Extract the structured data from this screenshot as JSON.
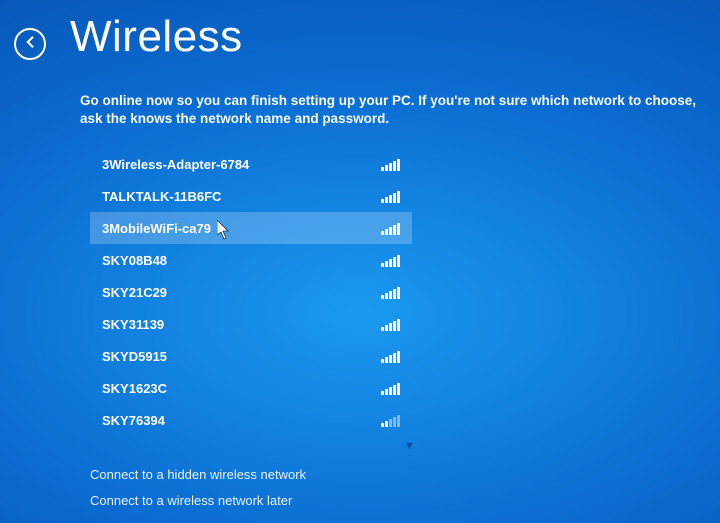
{
  "header": {
    "title": "Wireless"
  },
  "description": "Go online now so you can finish setting up your PC. If you're not sure which network to choose, ask the knows the network name and password.",
  "networks": [
    {
      "name": "3Wireless-Adapter-6784",
      "strength": 5,
      "selected": false
    },
    {
      "name": "TALKTALK-11B6FC",
      "strength": 5,
      "selected": false
    },
    {
      "name": "3MobileWiFi-ca79",
      "strength": 5,
      "selected": true
    },
    {
      "name": "SKY08B48",
      "strength": 5,
      "selected": false
    },
    {
      "name": "SKY21C29",
      "strength": 5,
      "selected": false
    },
    {
      "name": "SKY31139",
      "strength": 5,
      "selected": false
    },
    {
      "name": "SKYD5915",
      "strength": 5,
      "selected": false
    },
    {
      "name": "SKY1623C",
      "strength": 5,
      "selected": false
    },
    {
      "name": "SKY76394",
      "strength": 2,
      "selected": false
    }
  ],
  "links": {
    "hidden": "Connect to a hidden wireless network",
    "later": "Connect to a wireless network later"
  }
}
